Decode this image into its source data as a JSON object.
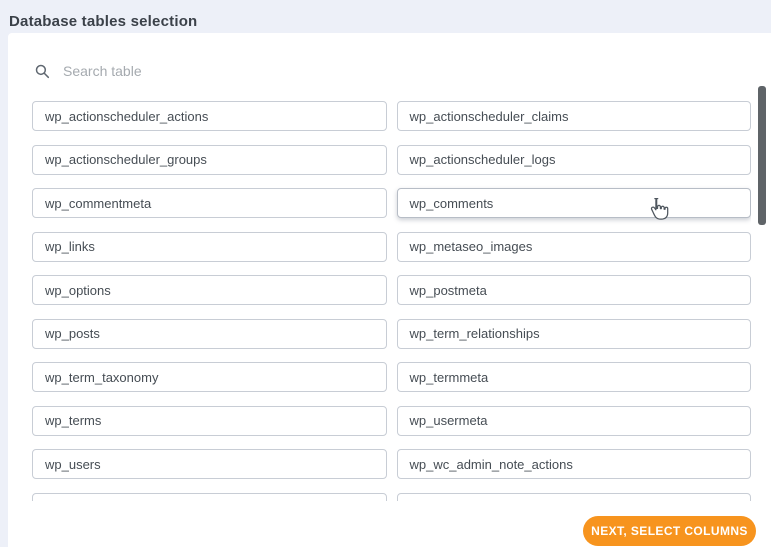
{
  "page": {
    "title": "Database tables selection"
  },
  "search": {
    "icon": "search-icon",
    "placeholder": "Search table",
    "value": ""
  },
  "tables": [
    "wp_actionscheduler_actions",
    "wp_actionscheduler_claims",
    "wp_actionscheduler_groups",
    "wp_actionscheduler_logs",
    "wp_commentmeta",
    "wp_comments",
    "wp_links",
    "wp_metaseo_images",
    "wp_options",
    "wp_postmeta",
    "wp_posts",
    "wp_term_relationships",
    "wp_term_taxonomy",
    "wp_termmeta",
    "wp_terms",
    "wp_usermeta",
    "wp_users",
    "wp_wc_admin_note_actions"
  ],
  "hovered_table": "wp_comments",
  "clipped_row_count": 2,
  "cursor": {
    "icon": "hand-cursor-icon"
  },
  "footer": {
    "next_button_label": "NEXT, SELECT COLUMNS"
  },
  "colors": {
    "accent_orange": "#F7941E",
    "page_background": "#EDF0F8",
    "card_background": "#FFFFFF",
    "box_border": "#C8CDD5",
    "title_text": "#3B4149",
    "item_text": "#464D54",
    "placeholder_text": "#A5AAAF",
    "scrollbar_thumb": "#5F6468"
  }
}
